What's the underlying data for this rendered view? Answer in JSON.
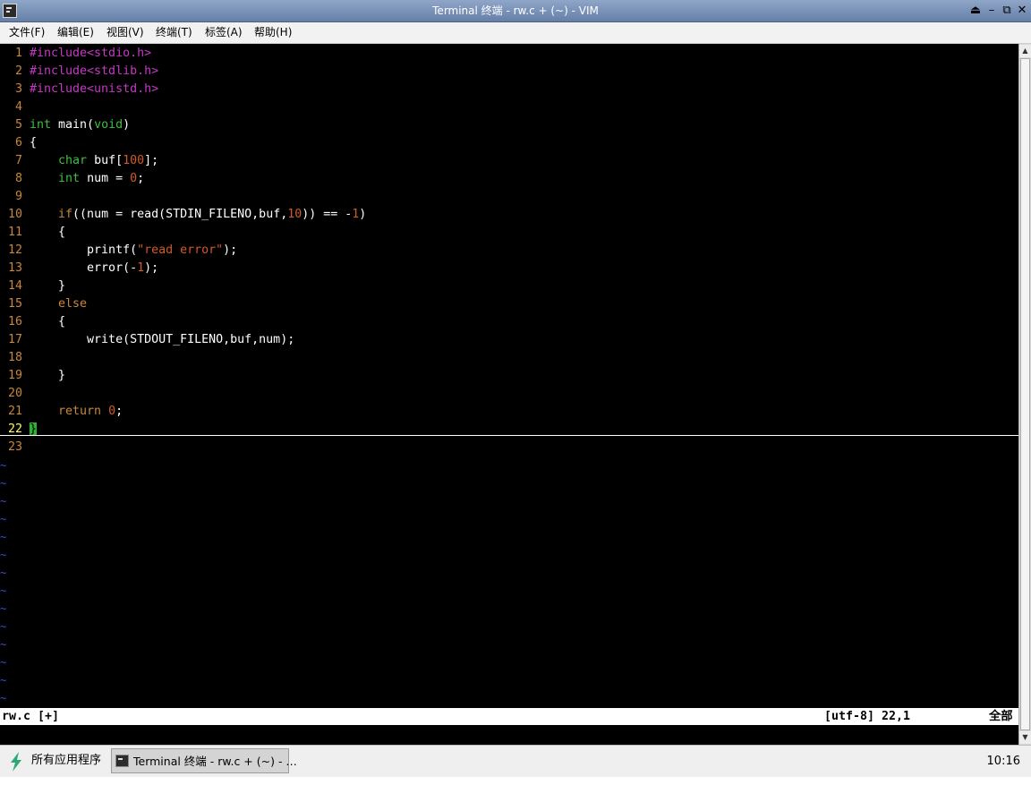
{
  "window": {
    "title": "Terminal 终端 - rw.c + (~) - VIM",
    "controls": {
      "shade": "⏏",
      "minimize": "–",
      "maximize": "⧉",
      "close": "✕"
    }
  },
  "menu": [
    "文件(F)",
    "编辑(E)",
    "视图(V)",
    "终端(T)",
    "标签(A)",
    "帮助(H)"
  ],
  "editor": {
    "current_line": 22,
    "tilde_char": "~",
    "tilde_count": 14,
    "lines": [
      {
        "n": "1",
        "tokens": [
          {
            "t": "#include<stdio.h>",
            "c": "pre"
          }
        ]
      },
      {
        "n": "2",
        "tokens": [
          {
            "t": "#include<stdlib.h>",
            "c": "pre"
          }
        ]
      },
      {
        "n": "3",
        "tokens": [
          {
            "t": "#include<unistd.h>",
            "c": "pre"
          }
        ]
      },
      {
        "n": "4",
        "tokens": []
      },
      {
        "n": "5",
        "tokens": [
          {
            "t": "int",
            "c": "type"
          },
          {
            "t": " main("
          },
          {
            "t": "void",
            "c": "type"
          },
          {
            "t": ")"
          }
        ]
      },
      {
        "n": "6",
        "tokens": [
          {
            "t": "{"
          }
        ]
      },
      {
        "n": "7",
        "tokens": [
          {
            "t": "    "
          },
          {
            "t": "char",
            "c": "type"
          },
          {
            "t": " buf["
          },
          {
            "t": "100",
            "c": "num"
          },
          {
            "t": "];"
          }
        ]
      },
      {
        "n": "8",
        "tokens": [
          {
            "t": "    "
          },
          {
            "t": "int",
            "c": "type"
          },
          {
            "t": " num = "
          },
          {
            "t": "0",
            "c": "num"
          },
          {
            "t": ";"
          }
        ]
      },
      {
        "n": "9",
        "tokens": []
      },
      {
        "n": "10",
        "tokens": [
          {
            "t": "    "
          },
          {
            "t": "if",
            "c": "kw"
          },
          {
            "t": "((num = read(STDIN_FILENO,buf,"
          },
          {
            "t": "10",
            "c": "num"
          },
          {
            "t": ")) == -"
          },
          {
            "t": "1",
            "c": "num"
          },
          {
            "t": ")"
          }
        ]
      },
      {
        "n": "11",
        "tokens": [
          {
            "t": "    {"
          }
        ]
      },
      {
        "n": "12",
        "tokens": [
          {
            "t": "        printf("
          },
          {
            "t": "\"read error\"",
            "c": "str"
          },
          {
            "t": ");"
          }
        ]
      },
      {
        "n": "13",
        "tokens": [
          {
            "t": "        error(-"
          },
          {
            "t": "1",
            "c": "num"
          },
          {
            "t": ");"
          }
        ]
      },
      {
        "n": "14",
        "tokens": [
          {
            "t": "    }"
          }
        ]
      },
      {
        "n": "15",
        "tokens": [
          {
            "t": "    "
          },
          {
            "t": "else",
            "c": "kw"
          }
        ]
      },
      {
        "n": "16",
        "tokens": [
          {
            "t": "    {"
          }
        ]
      },
      {
        "n": "17",
        "tokens": [
          {
            "t": "        write(STDOUT_FILENO,buf,num);"
          }
        ]
      },
      {
        "n": "18",
        "tokens": []
      },
      {
        "n": "19",
        "tokens": [
          {
            "t": "    }"
          }
        ]
      },
      {
        "n": "20",
        "tokens": []
      },
      {
        "n": "21",
        "tokens": [
          {
            "t": "    "
          },
          {
            "t": "return",
            "c": "kw"
          },
          {
            "t": " "
          },
          {
            "t": "0",
            "c": "num"
          },
          {
            "t": ";"
          }
        ]
      },
      {
        "n": "22",
        "tokens": [
          {
            "t": "}",
            "c": "cursor"
          }
        ]
      },
      {
        "n": "23",
        "tokens": []
      }
    ],
    "colors": {
      "pre": "#c638c6",
      "type": "#3fbf3f",
      "kw": "#c8873a",
      "num": "#d05a28",
      "line_number": "#c8873a",
      "current_line_number": "#ffff55",
      "cursor": "#2fb12f",
      "tilde": "#3a4fd8"
    }
  },
  "statusline": {
    "filename": "rw.c [+]",
    "encoding_pos": "[utf-8] 22,1",
    "scroll": "全部"
  },
  "taskbar": {
    "start_label": "所有应用程序",
    "task_label": "Terminal 终端 - rw.c + (~) - …",
    "clock": "10:16"
  }
}
